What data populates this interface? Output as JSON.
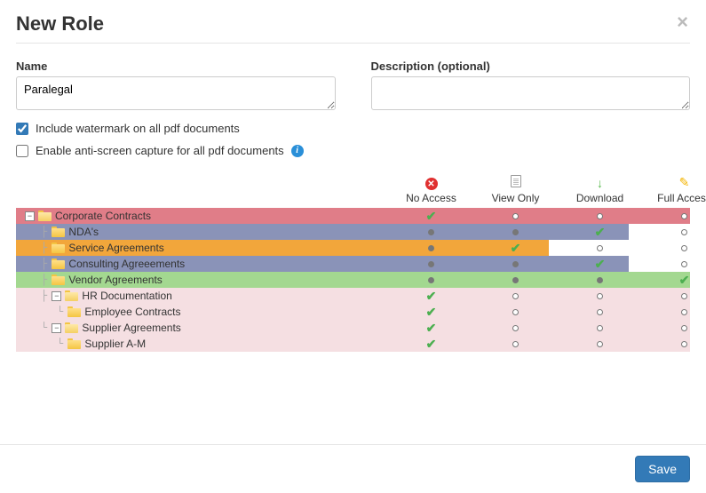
{
  "modal": {
    "title": "New Role",
    "close_label": "×"
  },
  "form": {
    "name_label": "Name",
    "name_value": "Paralegal",
    "desc_label": "Description (optional)",
    "desc_value": "",
    "watermark_label": "Include watermark on all pdf documents",
    "watermark_checked": true,
    "antiscreen_label": "Enable anti-screen capture for all pdf documents",
    "antiscreen_checked": false
  },
  "perm_columns": {
    "no_access": "No Access",
    "view_only": "View Only",
    "download": "Download",
    "full_access": "Full Access"
  },
  "tree": [
    {
      "label": "Corporate Contracts",
      "indent": 0,
      "toggle": "-",
      "open": true,
      "selected": "no_access",
      "row_class": "row-0"
    },
    {
      "label": "NDA's",
      "indent": 1,
      "toggle": "",
      "open": false,
      "selected": "download",
      "row_class": "row-1",
      "mid": true
    },
    {
      "label": "Service Agreements",
      "indent": 1,
      "toggle": "",
      "open": false,
      "selected": "view_only",
      "row_class": "row-2",
      "mid": true
    },
    {
      "label": "Consulting Agreeements",
      "indent": 1,
      "toggle": "",
      "open": false,
      "selected": "download",
      "row_class": "row-3",
      "mid": true
    },
    {
      "label": "Vendor Agreements",
      "indent": 1,
      "toggle": "",
      "open": false,
      "selected": "full_access",
      "row_class": "row-4",
      "mid": true
    },
    {
      "label": "HR Documentation",
      "indent": 1,
      "toggle": "-",
      "open": true,
      "selected": "no_access",
      "row_class": "row-5",
      "mid": true
    },
    {
      "label": "Employee Contracts",
      "indent": 2,
      "toggle": "",
      "open": false,
      "selected": "no_access",
      "row_class": "row-6",
      "last": true
    },
    {
      "label": "Supplier Agreements",
      "indent": 1,
      "toggle": "-",
      "open": true,
      "selected": "no_access",
      "row_class": "row-7",
      "last": true
    },
    {
      "label": "Supplier A-M",
      "indent": 2,
      "toggle": "",
      "open": false,
      "selected": "no_access",
      "row_class": "row-8",
      "last": true
    }
  ],
  "footer": {
    "save_label": "Save"
  }
}
